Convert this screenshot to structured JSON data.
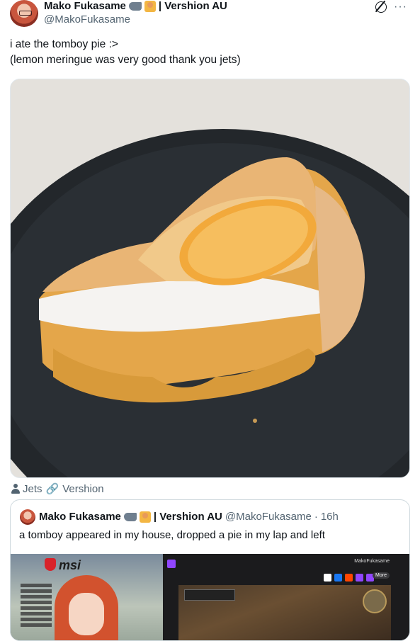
{
  "post": {
    "author_name": "Mako Fukasame",
    "author_suffix": "| Vershion AU",
    "handle": "@MakoFukasame",
    "text": "i ate the tomboy pie :>\n(lemon meringue was very good thank you jets)",
    "tags": [
      "Jets",
      "Vershion"
    ]
  },
  "icons": {
    "top_right": [
      "grok-icon",
      "more-icon"
    ],
    "emoji": [
      "shark-emoji",
      "person-emoji"
    ],
    "tag_icons": [
      "person-icon",
      "link-icon"
    ]
  },
  "quote": {
    "author_name": "Mako Fukasame",
    "author_suffix": "| Vershion AU",
    "handle": "@MakoFukasame",
    "separator": "·",
    "time": "16h",
    "text": "a tomboy appeared in my house, dropped a pie in my lap and left",
    "media": {
      "brand": "msi",
      "channel": "MakoFukasame",
      "more_label": "More"
    }
  },
  "colors": {
    "text_primary": "#0f1419",
    "text_secondary": "#536471",
    "border": "#cfd9de",
    "twitch": "#9146ff"
  }
}
